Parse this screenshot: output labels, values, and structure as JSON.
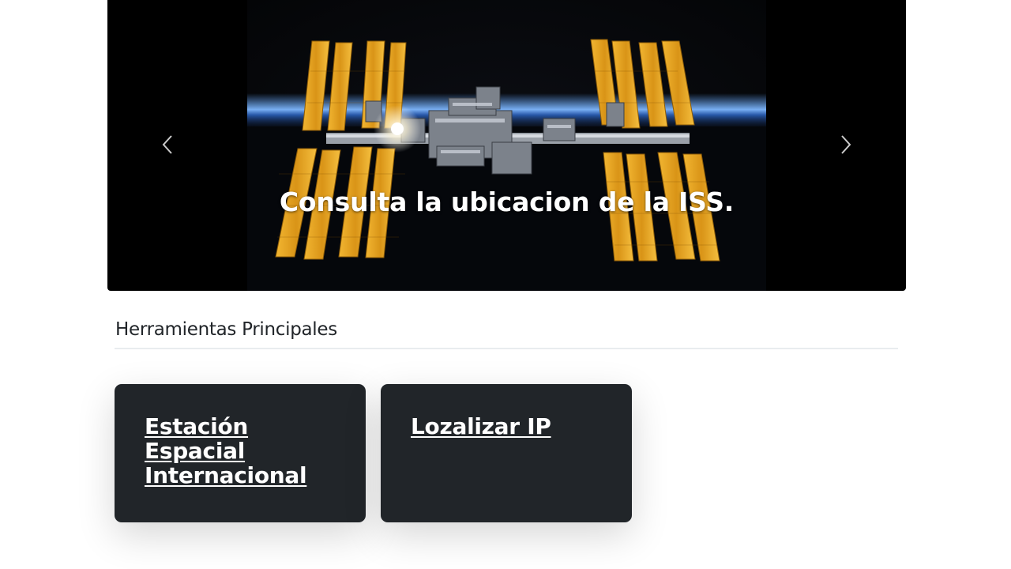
{
  "carousel": {
    "caption": "Consulta la ubicacion de la ISS.",
    "prev_icon": "chevron-left-icon",
    "next_icon": "chevron-right-icon"
  },
  "tools": {
    "title": "Herramientas Principales",
    "cards": [
      {
        "label": "Estación Espacial Internacional"
      },
      {
        "label": "Lozalizar IP"
      }
    ]
  },
  "colors": {
    "card_bg": "#212529",
    "panel_gold": "#e8a81f",
    "earth_blue": "#3f7fd6"
  }
}
